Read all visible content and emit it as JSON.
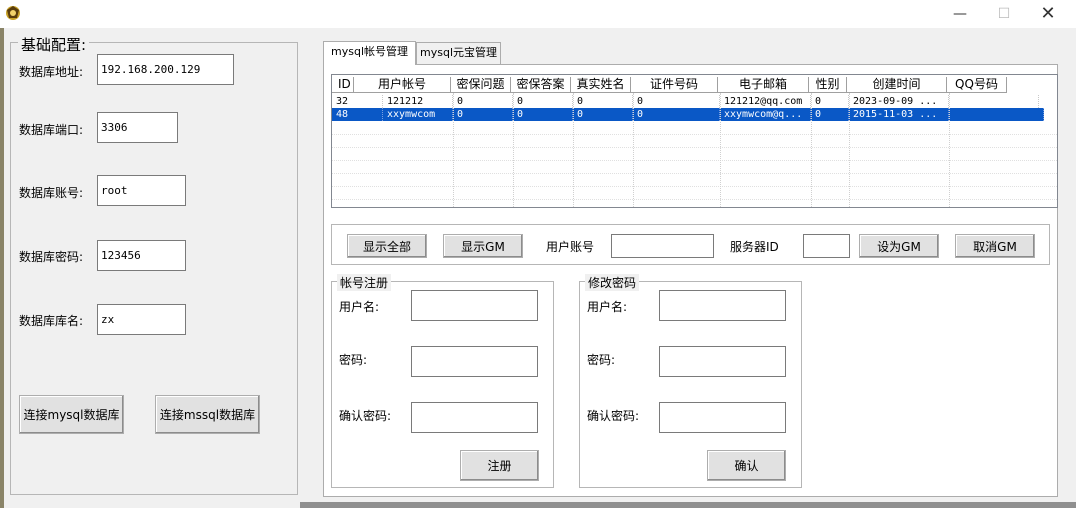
{
  "window": {
    "icon": "app-logo-icon",
    "min_label": "—",
    "max_label": "☐",
    "close_label": "✕"
  },
  "left_panel": {
    "title": "基础配置:",
    "fields": [
      {
        "label": "数据库地址:",
        "value": "192.168.200.129"
      },
      {
        "label": "数据库端口:",
        "value": "3306"
      },
      {
        "label": "数据库账号:",
        "value": "root"
      },
      {
        "label": "数据库密码:",
        "value": "123456"
      },
      {
        "label": "数据库库名:",
        "value": "zx"
      }
    ],
    "connect_mysql": "连接mysql数据库",
    "connect_mssql": "连接mssql数据库"
  },
  "tabs": [
    {
      "label": "mysql帐号管理",
      "active": true
    },
    {
      "label": "mysql元宝管理",
      "active": false
    }
  ],
  "table": {
    "columns": [
      "ID",
      "用户帐号",
      "密保问题",
      "密保答案",
      "真实姓名",
      "证件号码",
      "电子邮箱",
      "性别",
      "创建时间",
      "QQ号码"
    ],
    "rows": [
      [
        "32",
        "121212",
        "0",
        "0",
        "0",
        "0",
        "121212@qq.com",
        "0",
        "2023-09-09 ...",
        ""
      ],
      [
        "48",
        "xxymwcom",
        "0",
        "0",
        "0",
        "0",
        "xxymwcom@q...",
        "0",
        "2015-11-03 ...",
        ""
      ]
    ],
    "selected_row": 1
  },
  "toolbar": {
    "show_all": "显示全部",
    "show_gm": "显示GM",
    "user_account_label": "用户账号",
    "user_account_value": "",
    "server_id_label": "服务器ID",
    "server_id_value": "",
    "set_gm": "设为GM",
    "cancel_gm": "取消GM"
  },
  "register": {
    "title": "帐号注册",
    "username_label": "用户名:",
    "password_label": "密码:",
    "confirm_label": "确认密码:",
    "submit": "注册"
  },
  "change_password": {
    "title": "修改密码",
    "username_label": "用户名:",
    "password_label": "密码:",
    "confirm_label": "确认密码:",
    "submit": "确认"
  },
  "colors": {
    "selection": "#0a58c6",
    "background": "#f0f0f0"
  }
}
